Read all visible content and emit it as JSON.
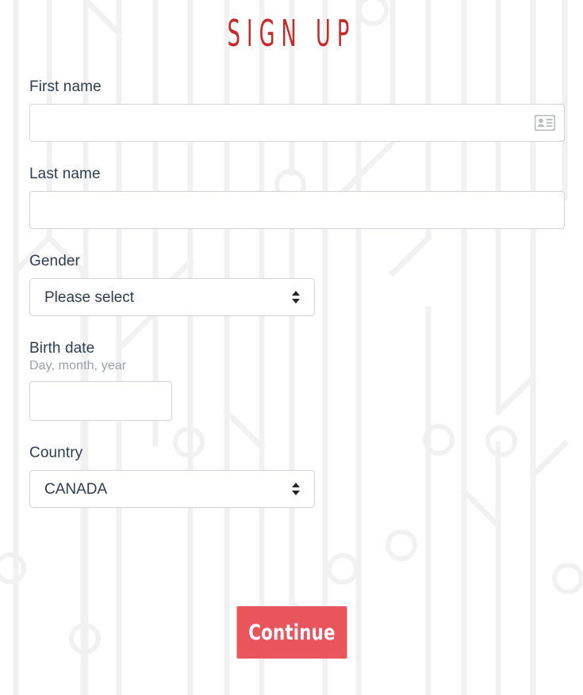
{
  "page": {
    "title": "SIGN UP",
    "title_color": "#c32a2a",
    "background_color": "#ffffff",
    "circuit_pattern_color": "#f1f1f1"
  },
  "form": {
    "fields": [
      {
        "key": "first_name",
        "label": "First name",
        "type": "text",
        "value": "",
        "placeholder": "",
        "icon": "id-card-icon"
      },
      {
        "key": "last_name",
        "label": "Last name",
        "type": "text",
        "value": "",
        "placeholder": ""
      },
      {
        "key": "gender",
        "label": "Gender",
        "type": "select",
        "selected": "Please select",
        "options": [
          "Please select"
        ]
      },
      {
        "key": "birth_date",
        "label": "Birth date",
        "sublabel": "Day, month, year",
        "type": "text",
        "value": "",
        "placeholder": ""
      },
      {
        "key": "country",
        "label": "Country",
        "type": "select",
        "selected": "CANADA",
        "options": [
          "CANADA"
        ]
      }
    ]
  },
  "actions": {
    "continue_label": "Continue",
    "continue_color": "#e8555c"
  }
}
